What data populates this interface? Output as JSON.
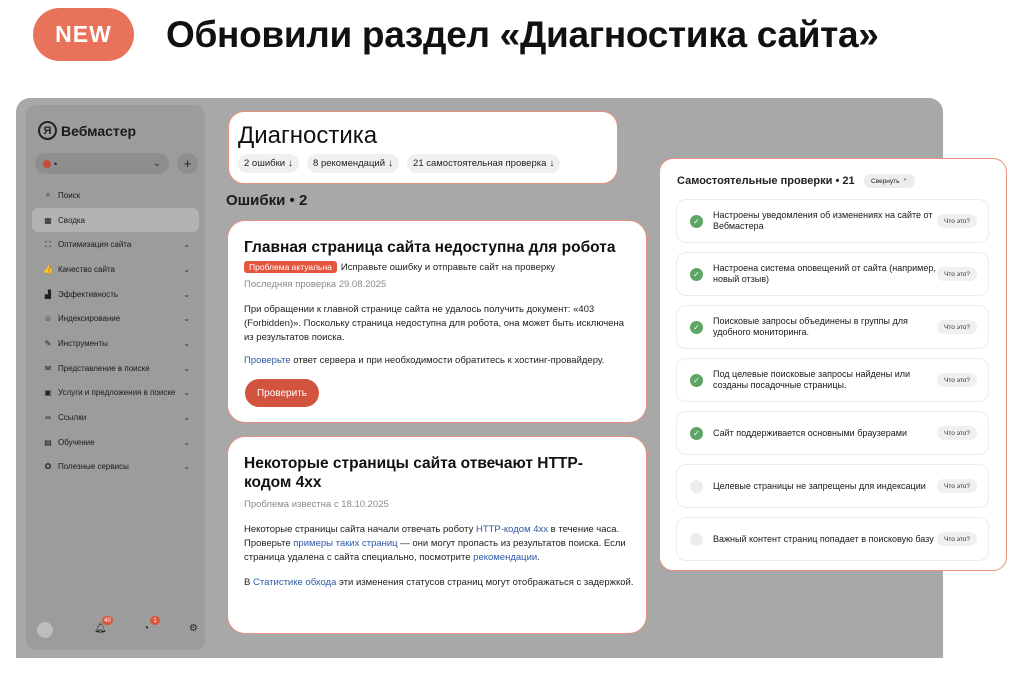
{
  "headline": {
    "badge": "NEW",
    "text": "Обновили раздел «Диагностика сайта»"
  },
  "colors": {
    "accent": "#e8735a",
    "error": "#d2543e",
    "ok": "#5ea463",
    "link": "#2d5aa7"
  },
  "sidebar": {
    "logo_mark": "Я",
    "logo_text": "Вебмастер",
    "site_name": "•",
    "add_label": "+",
    "items": [
      {
        "icon": "search-icon",
        "glyph": "⌕",
        "label": "Поиск",
        "chevron": ""
      },
      {
        "icon": "grid-icon",
        "glyph": "▦",
        "label": "Сводка",
        "chevron": ""
      },
      {
        "icon": "sitemap-icon",
        "glyph": "⛶",
        "label": "Оптимизация сайта",
        "chevron": "⌄"
      },
      {
        "icon": "thumb-icon",
        "glyph": "👍",
        "label": "Качество сайта",
        "chevron": "⌄"
      },
      {
        "icon": "chart-icon",
        "glyph": "▟",
        "label": "Эффективность",
        "chevron": "⌄"
      },
      {
        "icon": "robot-icon",
        "glyph": "☺",
        "label": "Индексирование",
        "chevron": "⌄"
      },
      {
        "icon": "tools-icon",
        "glyph": "✎",
        "label": "Инструменты",
        "chevron": "⌄"
      },
      {
        "icon": "megaphone-icon",
        "glyph": "✉",
        "label": "Представление в поиске",
        "chevron": "⌄"
      },
      {
        "icon": "bag-icon",
        "glyph": "▣",
        "label": "Услуги и предложения в поиске",
        "chevron": "⌄"
      },
      {
        "icon": "link-icon",
        "glyph": "∞",
        "label": "Ссылки",
        "chevron": "⌄"
      },
      {
        "icon": "book-icon",
        "glyph": "▤",
        "label": "Обучение",
        "chevron": "⌄"
      },
      {
        "icon": "star-icon",
        "glyph": "✪",
        "label": "Полезные сервисы",
        "chevron": "⌄"
      }
    ],
    "bottom": {
      "bell_badge": "40",
      "info_badge": "1"
    }
  },
  "diagnostics": {
    "title": "Диагностика",
    "chips": [
      {
        "label": "2 ошибки",
        "arrow": "↓"
      },
      {
        "label": "8 рекомендаций",
        "arrow": "↓"
      },
      {
        "label": "21 самостоятельная проверка",
        "arrow": "↓"
      }
    ],
    "errors_heading": "Ошибки • 2"
  },
  "card1": {
    "title": "Главная страница сайта недоступна для робота",
    "badge": "Проблема актуальна",
    "status_text": "Исправьте ошибку и отправьте сайт на проверку",
    "meta": "Последняя проверка 29.08.2025",
    "body": "При обращении к главной странице сайта не удалось получить документ: «403 (Forbidden)». Поскольку страница недоступна для робота, она может быть исключена из результатов поиска.",
    "link": "Проверьте",
    "link_rest": " ответ сервера и при необходимости обратитесь к хостинг-провайдеру.",
    "button": "Проверить"
  },
  "card2": {
    "title": "Некоторые страницы сайта отвечают HTTP-кодом 4xx",
    "meta": "Проблема известна с 18.10.2025",
    "p1_a": "Некоторые страницы сайта начали отвечать роботу ",
    "p1_link1": "HTTP-кодом 4xx",
    "p1_b": " в течение часа. Проверьте ",
    "p1_link2": "примеры таких страниц",
    "p1_c": " — они могут пропасть из результатов поиска. Если страница удалена с сайта специально, посмотрите ",
    "p1_link3": "рекомендации",
    "p1_d": ".",
    "p2_a": "В ",
    "p2_link": "Статистике обхода",
    "p2_b": " эти изменения статусов страниц могут отображаться с задержкой."
  },
  "checks": {
    "title": "Самостоятельные проверки • 21",
    "collapse": "Свернуть",
    "what_label": "Что это?",
    "items": [
      {
        "label": "Настроены уведомления об изменениях на сайте от Вебмастера",
        "ok": true
      },
      {
        "label": "Настроена система оповещений от сайта (например, новый отзыв)",
        "ok": true
      },
      {
        "label": "Поисковые запросы объединены в группы для удобного мониторинга.",
        "ok": true
      },
      {
        "label": "Под целевые поисковые запросы найдены или созданы посадочные страницы.",
        "ok": true
      },
      {
        "label": "Сайт поддерживается основными браузерами",
        "ok": true
      },
      {
        "label": "Целевые страницы не запрещены для индексации",
        "ok": false
      },
      {
        "label": "Важный контент страниц попадает в поисковую базу",
        "ok": false
      }
    ]
  }
}
